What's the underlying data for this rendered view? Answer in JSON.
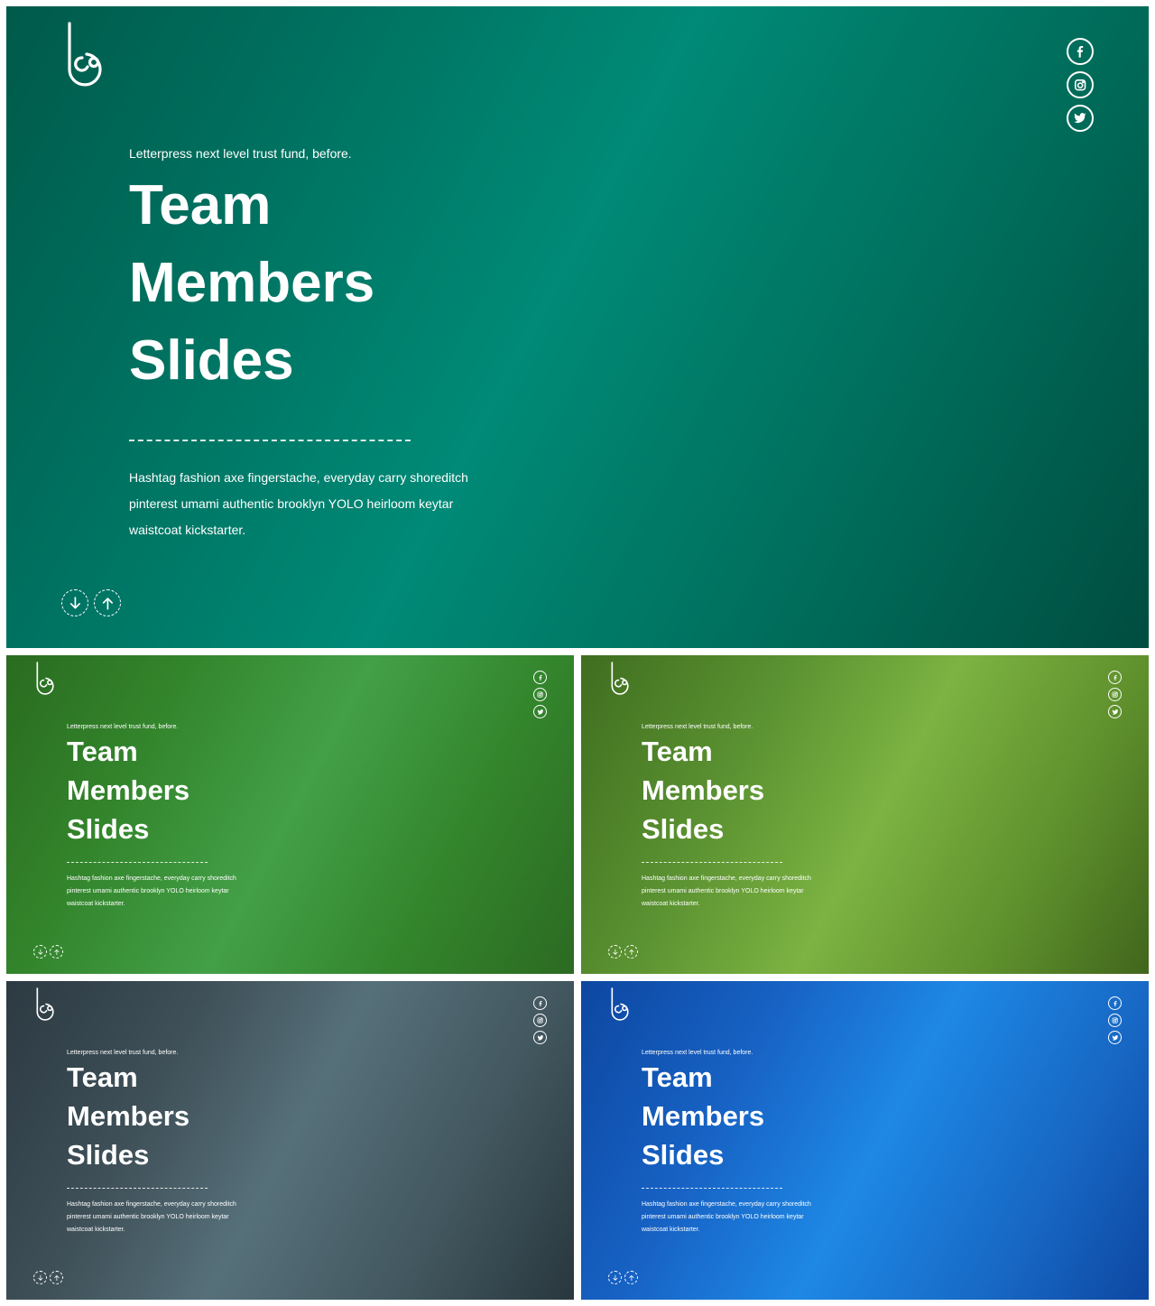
{
  "slide": {
    "eyebrow": "Letterpress next level trust fund, before.",
    "title_line1": "Team",
    "title_line2": "Members",
    "title_line3": "Slides",
    "description": "Hashtag fashion axe fingerstache, everyday carry shoreditch pinterest umami authentic brooklyn YOLO heirloom keytar waistcoat kickstarter.",
    "social": [
      {
        "name": "facebook-icon",
        "glyph": "f"
      },
      {
        "name": "instagram-icon",
        "glyph": ""
      },
      {
        "name": "twitter-icon",
        "glyph": ""
      }
    ],
    "nav": [
      "arrow-down-icon",
      "arrow-up-icon"
    ]
  },
  "variants": [
    {
      "name": "teal",
      "accent": "#008a77"
    },
    {
      "name": "green",
      "accent": "#43a047"
    },
    {
      "name": "lime",
      "accent": "#7cb342"
    },
    {
      "name": "slate",
      "accent": "#56707a"
    },
    {
      "name": "blue",
      "accent": "#1e88e5"
    }
  ]
}
